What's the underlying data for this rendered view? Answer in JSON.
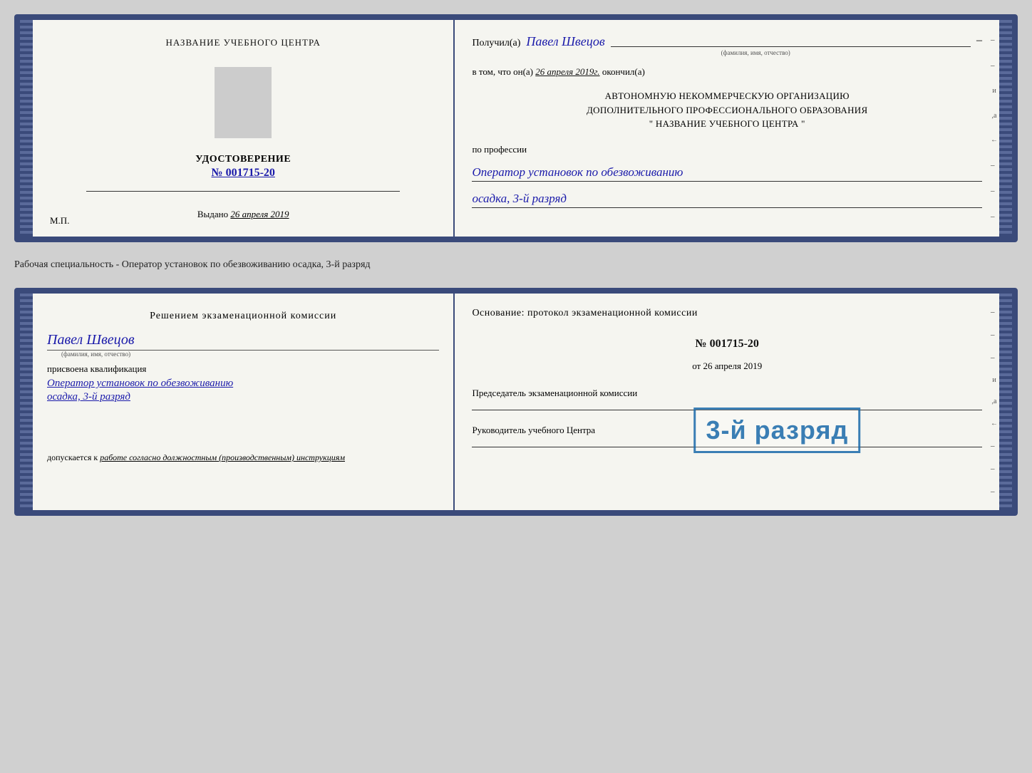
{
  "top_doc": {
    "left": {
      "center_title": "НАЗВАНИЕ УЧЕБНОГО ЦЕНТРА",
      "udostoverenie_label": "УДОСТОВЕРЕНИЕ",
      "number": "№ 001715-20",
      "vydano_label": "Выдано",
      "vydano_date": "26 апреля 2019",
      "mp": "М.П."
    },
    "right": {
      "poluchil_label": "Получил(а)",
      "poluchil_name": "Павел Швецов",
      "poluchil_subtitle": "(фамилия, имя, отчество)",
      "dash": "–",
      "vtom_prefix": "в том, что он(а)",
      "vtom_date": "26 апреля 2019г.",
      "vtom_suffix": "окончил(а)",
      "org_line1": "АВТОНОМНУЮ НЕКОММЕРЧЕСКУЮ ОРГАНИЗАЦИЮ",
      "org_line2": "ДОПОЛНИТЕЛЬНОГО ПРОФЕССИОНАЛЬНОГО ОБРАЗОВАНИЯ",
      "org_line3": "\"   НАЗВАНИЕ УЧЕБНОГО ЦЕНТРА   \"",
      "po_professii": "по профессии",
      "professiya": "Оператор установок по обезвоживанию",
      "razryad": "осадка, 3-й разряд"
    }
  },
  "separator": {
    "text": "Рабочая специальность - Оператор установок по обезвоживанию осадка, 3-й разряд"
  },
  "bottom_doc": {
    "left": {
      "resheniem_title": "Решением  экзаменационной  комиссии",
      "name": "Павел Швецов",
      "name_subtitle": "(фамилия, имя, отчество)",
      "prisvoena": "присвоена квалификация",
      "professiya": "Оператор установок по обезвоживанию",
      "razryad": "осадка, 3-й разряд",
      "dopuskaetsya_prefix": "допускается к",
      "dopuskaetsya_text": "работе согласно должностным (производственным) инструкциям"
    },
    "right": {
      "osnovanie_title": "Основание: протокол экзаменационной  комиссии",
      "number": "№  001715-20",
      "ot_prefix": "от",
      "ot_date": "26 апреля 2019",
      "predsedatel": "Председатель экзаменационной комиссии",
      "rukovoditel": "Руководитель учебного Центра"
    },
    "stamp": {
      "text": "3-й разряд"
    }
  },
  "right_deco": [
    "-",
    "и",
    ",а",
    "←",
    "-",
    "-",
    "-"
  ]
}
